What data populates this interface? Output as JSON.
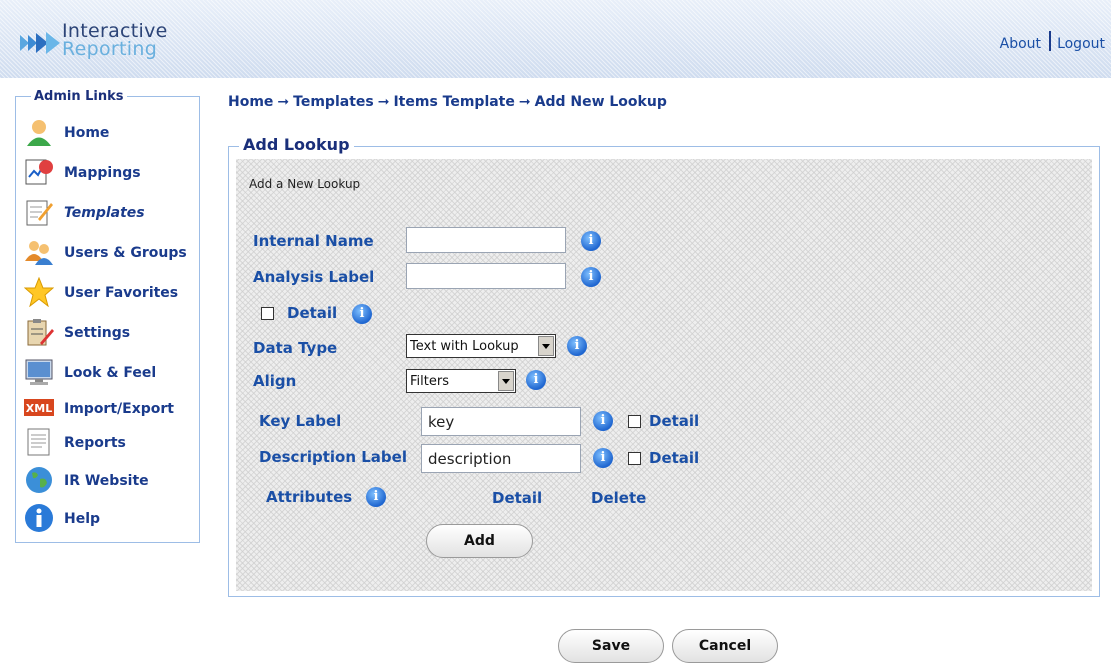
{
  "header": {
    "logo_line1": "Interactive",
    "logo_line2": "Reporting",
    "about": "About",
    "logout": "Logout"
  },
  "sidebar": {
    "title": "Admin Links",
    "items": [
      {
        "label": "Home",
        "icon": "user-icon"
      },
      {
        "label": "Mappings",
        "icon": "mappings-icon"
      },
      {
        "label": "Templates",
        "icon": "templates-icon"
      },
      {
        "label": "Users & Groups",
        "icon": "users-icon"
      },
      {
        "label": "User Favorites",
        "icon": "star-icon"
      },
      {
        "label": "Settings",
        "icon": "settings-icon"
      },
      {
        "label": "Look & Feel",
        "icon": "monitor-icon"
      },
      {
        "label": "Import/Export",
        "icon": "xml-icon"
      },
      {
        "label": "Reports",
        "icon": "report-icon"
      },
      {
        "label": "IR Website",
        "icon": "globe-icon"
      },
      {
        "label": "Help",
        "icon": "info-icon"
      }
    ]
  },
  "breadcrumb": {
    "home": "Home",
    "templates": "Templates",
    "items_template": "Items Template",
    "current": "Add New Lookup",
    "arrow": "➞"
  },
  "panel": {
    "title": "Add Lookup",
    "subtitle": "Add a New Lookup"
  },
  "form": {
    "internal_name_label": "Internal Name",
    "internal_name_value": "",
    "analysis_label_label": "Analysis Label",
    "analysis_label_value": "",
    "detail_label": "Detail",
    "data_type_label": "Data Type",
    "data_type_value": "Text with Lookup",
    "align_label": "Align",
    "align_value": "Filters",
    "key_label_label": "Key Label",
    "key_label_value": "key",
    "description_label_label": "Description Label",
    "description_label_value": "description",
    "attributes_label": "Attributes",
    "detail_col": "Detail",
    "delete_col": "Delete",
    "add_button": "Add"
  },
  "footer": {
    "save": "Save",
    "cancel": "Cancel"
  },
  "info_glyph": "i"
}
